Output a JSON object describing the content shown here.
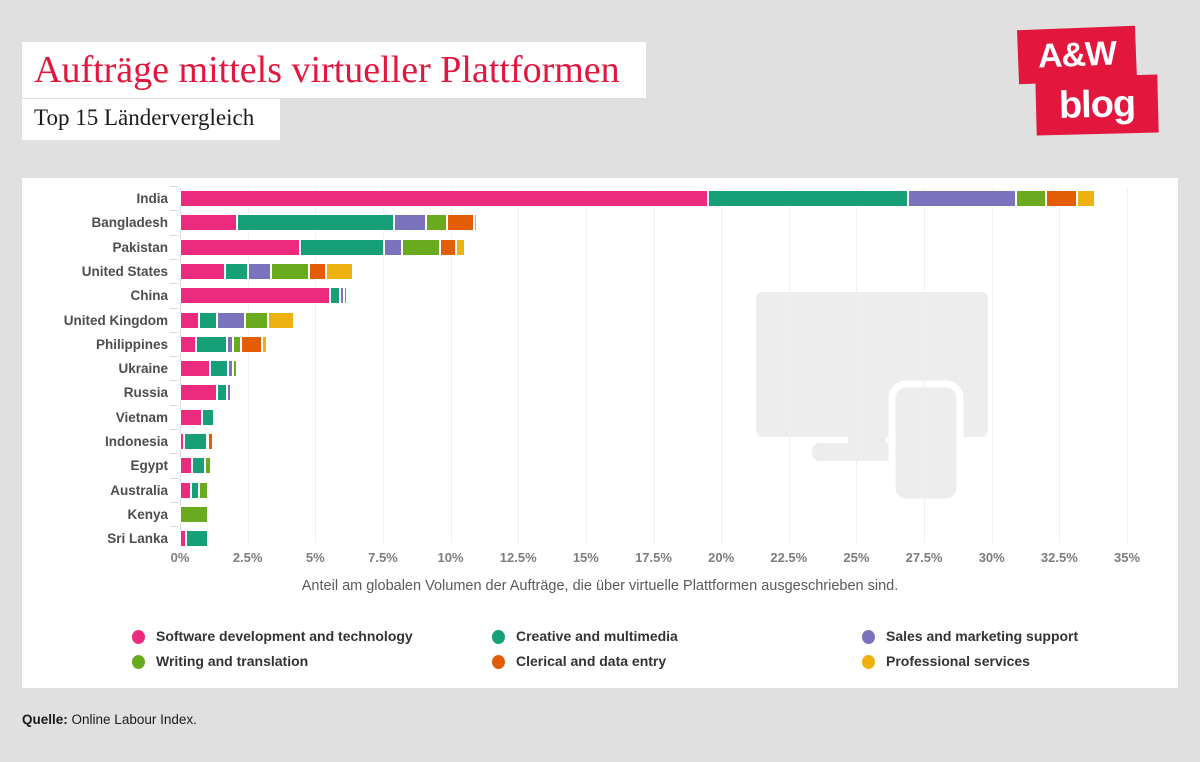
{
  "header": {
    "title": "Aufträge mittels virtueller Plattformen",
    "subtitle": "Top 15 Ländervergleich",
    "title_color": "#e3173e"
  },
  "logo": {
    "line1": "A&W",
    "line2": "blog",
    "color": "#e3173e"
  },
  "source": {
    "label": "Quelle:",
    "text": "Online Labour Index."
  },
  "chart_data": {
    "type": "bar",
    "orientation": "horizontal",
    "stacked": true,
    "title": "Aufträge mittels virtueller Plattformen",
    "subtitle": "Top 15 Ländervergleich",
    "xlabel": "Anteil am globalen Volumen der Aufträge, die über virtuelle Plattformen ausgeschrieben sind.",
    "ylabel": "",
    "xlim": [
      0,
      35
    ],
    "xtick_labels": [
      "0%",
      "2.5%",
      "5%",
      "7.5%",
      "10%",
      "12.5%",
      "15%",
      "17.5%",
      "20%",
      "22.5%",
      "25%",
      "27.5%",
      "30%",
      "32.5%",
      "35%"
    ],
    "xticks": [
      0,
      2.5,
      5,
      7.5,
      10,
      12.5,
      15,
      17.5,
      20,
      22.5,
      25,
      27.5,
      30,
      32.5,
      35
    ],
    "grid": true,
    "legend_position": "bottom",
    "categories": [
      "India",
      "Bangladesh",
      "Pakistan",
      "United States",
      "China",
      "United Kingdom",
      "Philippines",
      "Ukraine",
      "Russia",
      "Vietnam",
      "Indonesia",
      "Egypt",
      "Australia",
      "Kenya",
      "Sri Lanka"
    ],
    "series": [
      {
        "name": "Software development and technology",
        "color": "#ec2a7e",
        "values": [
          19.5,
          2.1,
          4.45,
          1.65,
          5.55,
          0.72,
          0.6,
          1.12,
          1.35,
          0.8,
          0.15,
          0.45,
          0.4,
          0.0,
          0.22
        ]
      },
      {
        "name": "Creative and multimedia",
        "color": "#17a078",
        "values": [
          7.4,
          5.8,
          3.1,
          0.85,
          0.35,
          0.65,
          1.12,
          0.65,
          0.4,
          0.47,
          0.85,
          0.47,
          0.32,
          0.0,
          0.83
        ]
      },
      {
        "name": "Sales and marketing support",
        "color": "#7b72bd",
        "values": [
          4.0,
          1.2,
          0.65,
          0.85,
          0.15,
          1.05,
          0.25,
          0.18,
          0.15,
          0.0,
          0.05,
          0.0,
          0.0,
          0.0,
          0.0
        ]
      },
      {
        "name": "Writing and translation",
        "color": "#6aaa1e",
        "values": [
          1.1,
          0.75,
          1.4,
          1.4,
          0.12,
          0.85,
          0.3,
          0.15,
          0.0,
          0.0,
          0.0,
          0.22,
          0.32,
          1.05,
          0.0
        ]
      },
      {
        "name": "Clerical and data entry",
        "color": "#e35d07",
        "values": [
          1.15,
          1.0,
          0.6,
          0.65,
          0.0,
          0.0,
          0.75,
          0.0,
          0.0,
          0.0,
          0.18,
          0.0,
          0.0,
          0.0,
          0.0
        ]
      },
      {
        "name": "Professional services",
        "color": "#edb211",
        "values": [
          0.65,
          0.12,
          0.35,
          1.0,
          0.0,
          0.93,
          0.18,
          0.0,
          0.0,
          0.0,
          0.0,
          0.0,
          0.0,
          0.0,
          0.0
        ]
      }
    ]
  }
}
